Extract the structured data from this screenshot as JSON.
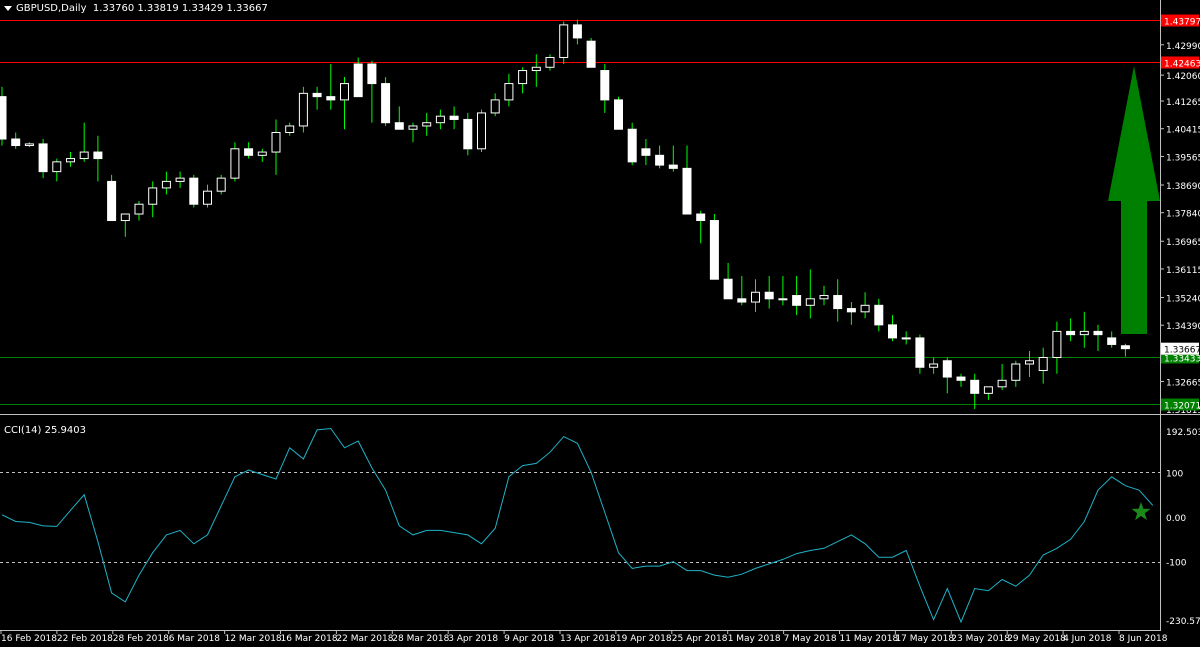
{
  "symbol_header": {
    "symbol": "GBPUSD,Daily",
    "ohlc": "1.33760 1.33819 1.33429 1.33667"
  },
  "indicator_header": {
    "name": "CCI(14)",
    "value": "25.9403"
  },
  "colors": {
    "background": "#000000",
    "bull_candle": "#ffffff",
    "bear_candle": "#ffffff",
    "wick": "#00ff00",
    "resistance_line": "#ff0000",
    "support_line": "#008000",
    "cci_line": "#20b2c8",
    "arrow": "#008000",
    "star": "#1b8a1b"
  },
  "annotations": {
    "arrow": "up-arrow",
    "star": "star-icon"
  },
  "chart_data": [
    {
      "type": "candlestick",
      "title": "GBPUSD,Daily",
      "ylim": [
        1.3182,
        1.4375
      ],
      "y_ticks": [
        "1.42990",
        "1.42060",
        "1.41265",
        "1.40415",
        "1.39565",
        "1.38690",
        "1.37840",
        "1.36965",
        "1.36115",
        "1.35240",
        "1.34390",
        "1.32665",
        "1.31815"
      ],
      "current_price_label": "1.33667",
      "price_lines": [
        {
          "label": "1.43797",
          "value": 1.4375,
          "kind": "resistance"
        },
        {
          "label": "1.42463",
          "value": 1.4246,
          "kind": "resistance"
        },
        {
          "label": "1.33433",
          "value": 1.3343,
          "kind": "support"
        },
        {
          "label": "1.32071",
          "value": 1.3196,
          "kind": "support"
        }
      ],
      "x_ticks": [
        "16 Feb 2018",
        "22 Feb 2018",
        "28 Feb 2018",
        "6 Mar 2018",
        "12 Mar 2018",
        "16 Mar 2018",
        "22 Mar 2018",
        "28 Mar 2018",
        "3 Apr 2018",
        "9 Apr 2018",
        "13 Apr 2018",
        "19 Apr 2018",
        "25 Apr 2018",
        "1 May 2018",
        "7 May 2018",
        "11 May 2018",
        "17 May 2018",
        "23 May 2018",
        "29 May 2018",
        "4 Jun 2018",
        "8 Jun 2018"
      ],
      "candles": [
        [
          1.414,
          1.417,
          1.399,
          1.401
        ],
        [
          1.401,
          1.403,
          1.398,
          1.399
        ],
        [
          1.399,
          1.4,
          1.3985,
          1.3995
        ],
        [
          1.3995,
          1.401,
          1.389,
          1.391
        ],
        [
          1.391,
          1.395,
          1.388,
          1.394
        ],
        [
          1.394,
          1.397,
          1.3925,
          1.395
        ],
        [
          1.395,
          1.406,
          1.394,
          1.397
        ],
        [
          1.397,
          1.402,
          1.388,
          1.395
        ],
        [
          1.388,
          1.39,
          1.376,
          1.376
        ],
        [
          1.376,
          1.378,
          1.371,
          1.378
        ],
        [
          1.378,
          1.382,
          1.376,
          1.381
        ],
        [
          1.381,
          1.388,
          1.377,
          1.386
        ],
        [
          1.386,
          1.391,
          1.384,
          1.388
        ],
        [
          1.388,
          1.391,
          1.386,
          1.389
        ],
        [
          1.389,
          1.39,
          1.38,
          1.381
        ],
        [
          1.381,
          1.387,
          1.38,
          1.385
        ],
        [
          1.385,
          1.39,
          1.384,
          1.389
        ],
        [
          1.389,
          1.4,
          1.388,
          1.398
        ],
        [
          1.398,
          1.4,
          1.395,
          1.396
        ],
        [
          1.396,
          1.398,
          1.394,
          1.397
        ],
        [
          1.397,
          1.407,
          1.39,
          1.403
        ],
        [
          1.403,
          1.406,
          1.402,
          1.405
        ],
        [
          1.405,
          1.417,
          1.403,
          1.415
        ],
        [
          1.415,
          1.417,
          1.41,
          1.414
        ],
        [
          1.414,
          1.424,
          1.41,
          1.413
        ],
        [
          1.413,
          1.42,
          1.404,
          1.418
        ],
        [
          1.424,
          1.426,
          1.414,
          1.414
        ],
        [
          1.424,
          1.425,
          1.406,
          1.418
        ],
        [
          1.418,
          1.42,
          1.405,
          1.406
        ],
        [
          1.406,
          1.411,
          1.404,
          1.404
        ],
        [
          1.404,
          1.406,
          1.4,
          1.405
        ],
        [
          1.405,
          1.409,
          1.402,
          1.406
        ],
        [
          1.406,
          1.41,
          1.404,
          1.408
        ],
        [
          1.408,
          1.411,
          1.404,
          1.407
        ],
        [
          1.407,
          1.409,
          1.396,
          1.398
        ],
        [
          1.398,
          1.41,
          1.397,
          1.409
        ],
        [
          1.409,
          1.415,
          1.408,
          1.413
        ],
        [
          1.413,
          1.421,
          1.411,
          1.418
        ],
        [
          1.418,
          1.423,
          1.415,
          1.422
        ],
        [
          1.422,
          1.427,
          1.417,
          1.423
        ],
        [
          1.423,
          1.427,
          1.422,
          1.426
        ],
        [
          1.426,
          1.437,
          1.424,
          1.436
        ],
        [
          1.436,
          1.4376,
          1.43,
          1.432
        ],
        [
          1.431,
          1.432,
          1.423,
          1.423
        ],
        [
          1.422,
          1.424,
          1.409,
          1.413
        ],
        [
          1.413,
          1.414,
          1.404,
          1.404
        ],
        [
          1.404,
          1.406,
          1.393,
          1.394
        ],
        [
          1.398,
          1.401,
          1.393,
          1.396
        ],
        [
          1.396,
          1.399,
          1.392,
          1.393
        ],
        [
          1.393,
          1.399,
          1.391,
          1.392
        ],
        [
          1.392,
          1.399,
          1.378,
          1.378
        ],
        [
          1.378,
          1.379,
          1.369,
          1.376
        ],
        [
          1.376,
          1.378,
          1.358,
          1.358
        ],
        [
          1.358,
          1.363,
          1.352,
          1.352
        ],
        [
          1.352,
          1.359,
          1.35,
          1.351
        ],
        [
          1.351,
          1.358,
          1.348,
          1.354
        ],
        [
          1.354,
          1.359,
          1.349,
          1.352
        ],
        [
          1.352,
          1.359,
          1.35,
          1.352
        ],
        [
          1.353,
          1.359,
          1.347,
          1.35
        ],
        [
          1.35,
          1.361,
          1.346,
          1.352
        ],
        [
          1.352,
          1.356,
          1.35,
          1.353
        ],
        [
          1.353,
          1.358,
          1.345,
          1.349
        ],
        [
          1.349,
          1.351,
          1.344,
          1.348
        ],
        [
          1.348,
          1.354,
          1.346,
          1.35
        ],
        [
          1.35,
          1.352,
          1.342,
          1.344
        ],
        [
          1.344,
          1.347,
          1.339,
          1.34
        ],
        [
          1.34,
          1.342,
          1.338,
          1.34
        ],
        [
          1.34,
          1.341,
          1.329,
          1.331
        ],
        [
          1.331,
          1.334,
          1.329,
          1.332
        ],
        [
          1.333,
          1.334,
          1.323,
          1.328
        ],
        [
          1.328,
          1.329,
          1.325,
          1.327
        ],
        [
          1.327,
          1.329,
          1.3182,
          1.323
        ],
        [
          1.323,
          1.325,
          1.321,
          1.325
        ],
        [
          1.325,
          1.332,
          1.324,
          1.327
        ],
        [
          1.327,
          1.333,
          1.325,
          1.332
        ],
        [
          1.332,
          1.336,
          1.328,
          1.333
        ],
        [
          1.33,
          1.337,
          1.326,
          1.334
        ],
        [
          1.334,
          1.345,
          1.329,
          1.342
        ],
        [
          1.342,
          1.346,
          1.339,
          1.341
        ],
        [
          1.341,
          1.348,
          1.337,
          1.342
        ],
        [
          1.342,
          1.344,
          1.336,
          1.341
        ],
        [
          1.34,
          1.342,
          1.337,
          1.338
        ],
        [
          1.3376,
          1.3382,
          1.3343,
          1.3367
        ]
      ]
    },
    {
      "type": "line",
      "title": "CCI(14)",
      "ylim": [
        -230.573,
        192.5032
      ],
      "y_ticks": [
        "192.5032",
        "100",
        "0.00",
        "-100",
        "-230.573"
      ],
      "levels": [
        100,
        -100
      ],
      "values": [
        5,
        -10,
        -12,
        -20,
        -21,
        15,
        50,
        -55,
        -170,
        -190,
        -130,
        -80,
        -40,
        -30,
        -60,
        -40,
        25,
        90,
        105,
        95,
        85,
        155,
        130,
        195,
        198,
        155,
        170,
        110,
        60,
        -20,
        -40,
        -30,
        -30,
        -35,
        -40,
        -60,
        -25,
        90,
        115,
        120,
        145,
        180,
        165,
        100,
        10,
        -80,
        -115,
        -110,
        -110,
        -100,
        -120,
        -120,
        -130,
        -135,
        -128,
        -115,
        -105,
        -95,
        -82,
        -75,
        -70,
        -55,
        -40,
        -60,
        -90,
        -90,
        -75,
        -155,
        -230,
        -160,
        -235,
        -160,
        -165,
        -140,
        -155,
        -130,
        -85,
        -70,
        -50,
        -10,
        60,
        90,
        70,
        60,
        26
      ]
    }
  ]
}
